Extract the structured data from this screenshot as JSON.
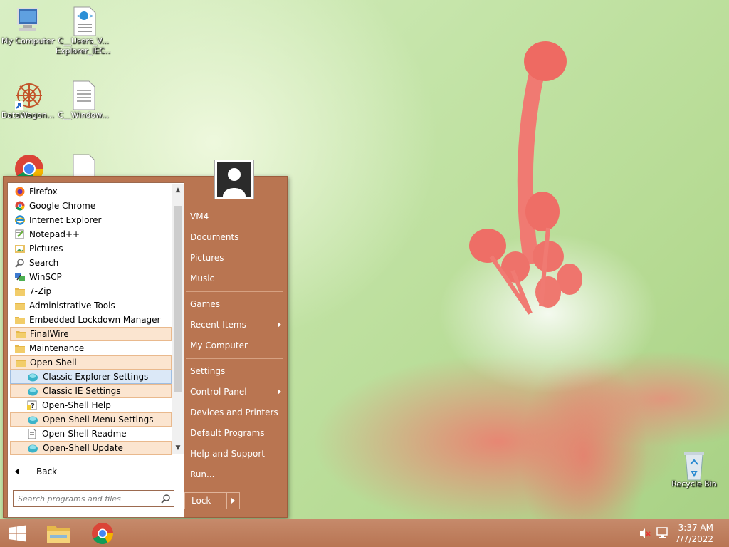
{
  "desktop": {
    "icons": [
      {
        "label": "My Computer"
      },
      {
        "label": "C__Users_V... Explorer_IEC..."
      },
      {
        "label": "DataWagon..."
      },
      {
        "label": "C__Window..."
      },
      {
        "label": "Recycle Bin"
      }
    ]
  },
  "start_menu": {
    "programs": [
      {
        "label": "Firefox",
        "icon": "firefox-icon"
      },
      {
        "label": "Google Chrome",
        "icon": "chrome-icon"
      },
      {
        "label": "Internet Explorer",
        "icon": "internet-explorer-icon"
      },
      {
        "label": "Notepad++",
        "icon": "notepad-plus-plus-icon"
      },
      {
        "label": "Pictures",
        "icon": "pictures-icon"
      },
      {
        "label": "Search",
        "icon": "search-icon"
      },
      {
        "label": "WinSCP",
        "icon": "winscp-icon"
      },
      {
        "label": "7-Zip",
        "icon": "folder-icon"
      },
      {
        "label": "Administrative Tools",
        "icon": "folder-icon"
      },
      {
        "label": "Embedded Lockdown Manager",
        "icon": "folder-icon"
      },
      {
        "label": "FinalWire",
        "icon": "folder-icon"
      },
      {
        "label": "Maintenance",
        "icon": "folder-icon"
      },
      {
        "label": "Open-Shell",
        "icon": "folder-icon"
      },
      {
        "label": "Classic Explorer Settings",
        "icon": "shell-icon"
      },
      {
        "label": "Classic IE Settings",
        "icon": "shell-icon"
      },
      {
        "label": "Open-Shell Help",
        "icon": "help-icon"
      },
      {
        "label": "Open-Shell Menu Settings",
        "icon": "shell-icon"
      },
      {
        "label": "Open-Shell Readme",
        "icon": "document-icon"
      },
      {
        "label": "Open-Shell Update",
        "icon": "shell-icon"
      }
    ],
    "back_label": "Back",
    "search_placeholder": "Search programs and files",
    "right_items": [
      {
        "label": "VM4"
      },
      {
        "label": "Documents"
      },
      {
        "label": "Pictures"
      },
      {
        "label": "Music"
      },
      {
        "label": "Games"
      },
      {
        "label": "Recent Items"
      },
      {
        "label": "My Computer"
      },
      {
        "label": "Settings"
      },
      {
        "label": "Control Panel"
      },
      {
        "label": "Devices and Printers"
      },
      {
        "label": "Default Programs"
      },
      {
        "label": "Help and Support"
      },
      {
        "label": "Run..."
      }
    ],
    "lock_label": "Lock"
  },
  "taskbar": {
    "time": "3:37 AM",
    "date": "7/7/2022"
  },
  "colors": {
    "menu_bg": "#b97551",
    "taskbar_bg": "#c07f5f",
    "highlight": "#fbe5d0",
    "selected": "#dbe8f7"
  }
}
